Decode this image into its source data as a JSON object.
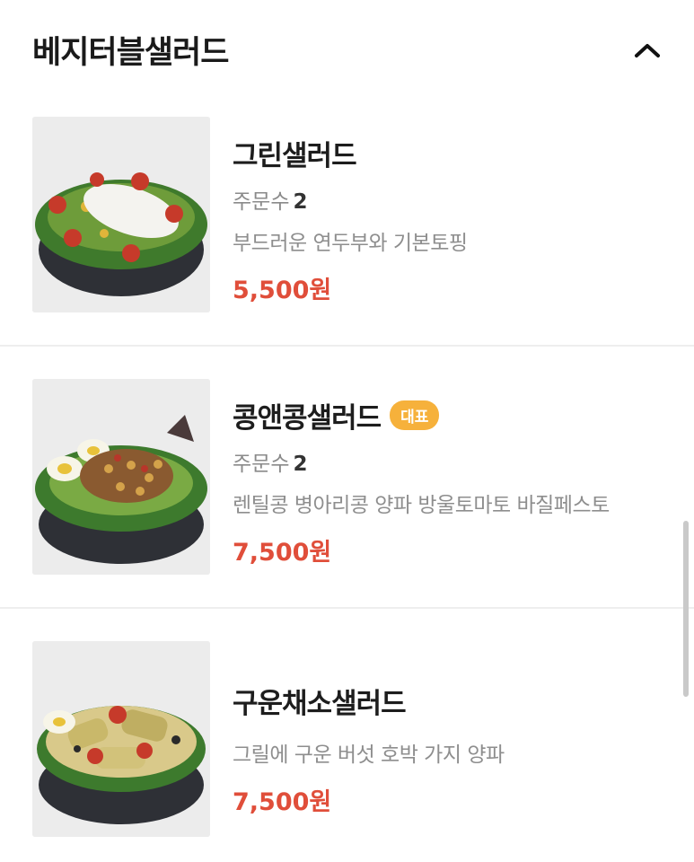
{
  "section": {
    "title": "베지터블샐러드",
    "toggle_icon": "chevron-up-icon"
  },
  "items": [
    {
      "name": "그린샐러드",
      "order_label": "주문수",
      "order_count": "2",
      "description": "부드러운 연두부와 기본토핑",
      "price": "5,500원"
    },
    {
      "name": "콩앤콩샐러드",
      "badge": "대표",
      "order_label": "주문수",
      "order_count": "2",
      "description": "렌틸콩 병아리콩 양파 방울토마토 바질페스토",
      "price": "7,500원"
    },
    {
      "name": "구운채소샐러드",
      "description": "그릴에 구운 버섯 호박 가지 양파",
      "price": "7,500원"
    }
  ],
  "colors": {
    "price": "#e04e3a",
    "badge": "#f6b13b"
  }
}
